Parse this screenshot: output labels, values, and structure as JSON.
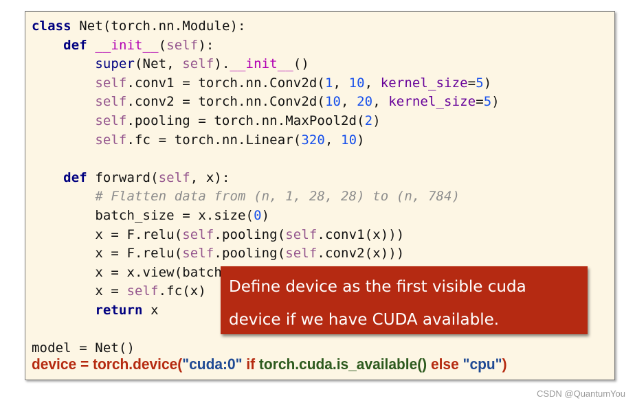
{
  "code_lines": [
    [
      [
        "class",
        "kw"
      ],
      [
        " Net(torch.nn.Module):",
        "plain"
      ]
    ],
    [
      [
        "    ",
        "plain"
      ],
      [
        "def",
        "kw"
      ],
      [
        " ",
        "plain"
      ],
      [
        "__init__",
        "magic"
      ],
      [
        "(",
        "plain"
      ],
      [
        "self",
        "self"
      ],
      [
        "):",
        "plain"
      ]
    ],
    [
      [
        "        ",
        "plain"
      ],
      [
        "super",
        "bi"
      ],
      [
        "(Net, ",
        "plain"
      ],
      [
        "self",
        "self"
      ],
      [
        ").",
        "plain"
      ],
      [
        "__init__",
        "magic"
      ],
      [
        "()",
        "plain"
      ]
    ],
    [
      [
        "        ",
        "plain"
      ],
      [
        "self",
        "self"
      ],
      [
        ".conv1 = torch.nn.Conv2d(",
        "plain"
      ],
      [
        "1",
        "num"
      ],
      [
        ", ",
        "plain"
      ],
      [
        "10",
        "num"
      ],
      [
        ", ",
        "plain"
      ],
      [
        "kernel_size",
        "kwarg"
      ],
      [
        "=",
        "plain"
      ],
      [
        "5",
        "num"
      ],
      [
        ")",
        "plain"
      ]
    ],
    [
      [
        "        ",
        "plain"
      ],
      [
        "self",
        "self"
      ],
      [
        ".conv2 = torch.nn.Conv2d(",
        "plain"
      ],
      [
        "10",
        "num"
      ],
      [
        ", ",
        "plain"
      ],
      [
        "20",
        "num"
      ],
      [
        ", ",
        "plain"
      ],
      [
        "kernel_size",
        "kwarg"
      ],
      [
        "=",
        "plain"
      ],
      [
        "5",
        "num"
      ],
      [
        ")",
        "plain"
      ]
    ],
    [
      [
        "        ",
        "plain"
      ],
      [
        "self",
        "self"
      ],
      [
        ".pooling = torch.nn.MaxPool2d(",
        "plain"
      ],
      [
        "2",
        "num"
      ],
      [
        ")",
        "plain"
      ]
    ],
    [
      [
        "        ",
        "plain"
      ],
      [
        "self",
        "self"
      ],
      [
        ".fc = torch.nn.Linear(",
        "plain"
      ],
      [
        "320",
        "num"
      ],
      [
        ", ",
        "plain"
      ],
      [
        "10",
        "num"
      ],
      [
        ")",
        "plain"
      ]
    ],
    [],
    [
      [
        "    ",
        "plain"
      ],
      [
        "def",
        "kw"
      ],
      [
        " forward(",
        "plain"
      ],
      [
        "self",
        "self"
      ],
      [
        ", x):",
        "plain"
      ]
    ],
    [
      [
        "        ",
        "plain"
      ],
      [
        "# Flatten data from (n, 1, 28, 28) to (n, 784)",
        "cmt"
      ]
    ],
    [
      [
        "        ",
        "plain"
      ],
      [
        "batch_size = x.size(",
        "plain"
      ],
      [
        "0",
        "num"
      ],
      [
        ")",
        "plain"
      ]
    ],
    [
      [
        "        ",
        "plain"
      ],
      [
        "x = F.relu(",
        "plain"
      ],
      [
        "self",
        "self"
      ],
      [
        ".pooling(",
        "plain"
      ],
      [
        "self",
        "self"
      ],
      [
        ".conv1(x)))",
        "plain"
      ]
    ],
    [
      [
        "        ",
        "plain"
      ],
      [
        "x = F.relu(",
        "plain"
      ],
      [
        "self",
        "self"
      ],
      [
        ".pooling(",
        "plain"
      ],
      [
        "self",
        "self"
      ],
      [
        ".conv2(x)))",
        "plain"
      ]
    ],
    [
      [
        "        ",
        "plain"
      ],
      [
        "x = x.view(batch",
        "plain"
      ]
    ],
    [
      [
        "        ",
        "plain"
      ],
      [
        "x = ",
        "plain"
      ],
      [
        "self",
        "self"
      ],
      [
        ".fc(x)",
        "plain"
      ]
    ],
    [
      [
        "        ",
        "plain"
      ],
      [
        "return",
        "kw"
      ],
      [
        " x",
        "plain"
      ]
    ],
    [],
    [
      [
        "model = Net()",
        "plain"
      ]
    ]
  ],
  "device_line": [
    [
      "device = torch.device(",
      "dred"
    ],
    [
      "\"cuda:0\"",
      "dblue"
    ],
    [
      " if ",
      "dred"
    ],
    [
      "torch.cuda.is_available()",
      "dgreen"
    ],
    [
      " else ",
      "dred"
    ],
    [
      "\"cpu\"",
      "dblue"
    ],
    [
      ")",
      "dred"
    ]
  ],
  "callout": {
    "line1": "Define device as the first visible cuda",
    "line2": "device if we have CUDA available."
  },
  "watermark": "CSDN @QuantumYou",
  "colors": {
    "callout_bg": "#b52a12",
    "code_bg": "#fdf6e4",
    "keyword": "#000080",
    "number": "#1750eb",
    "self": "#94558d"
  }
}
